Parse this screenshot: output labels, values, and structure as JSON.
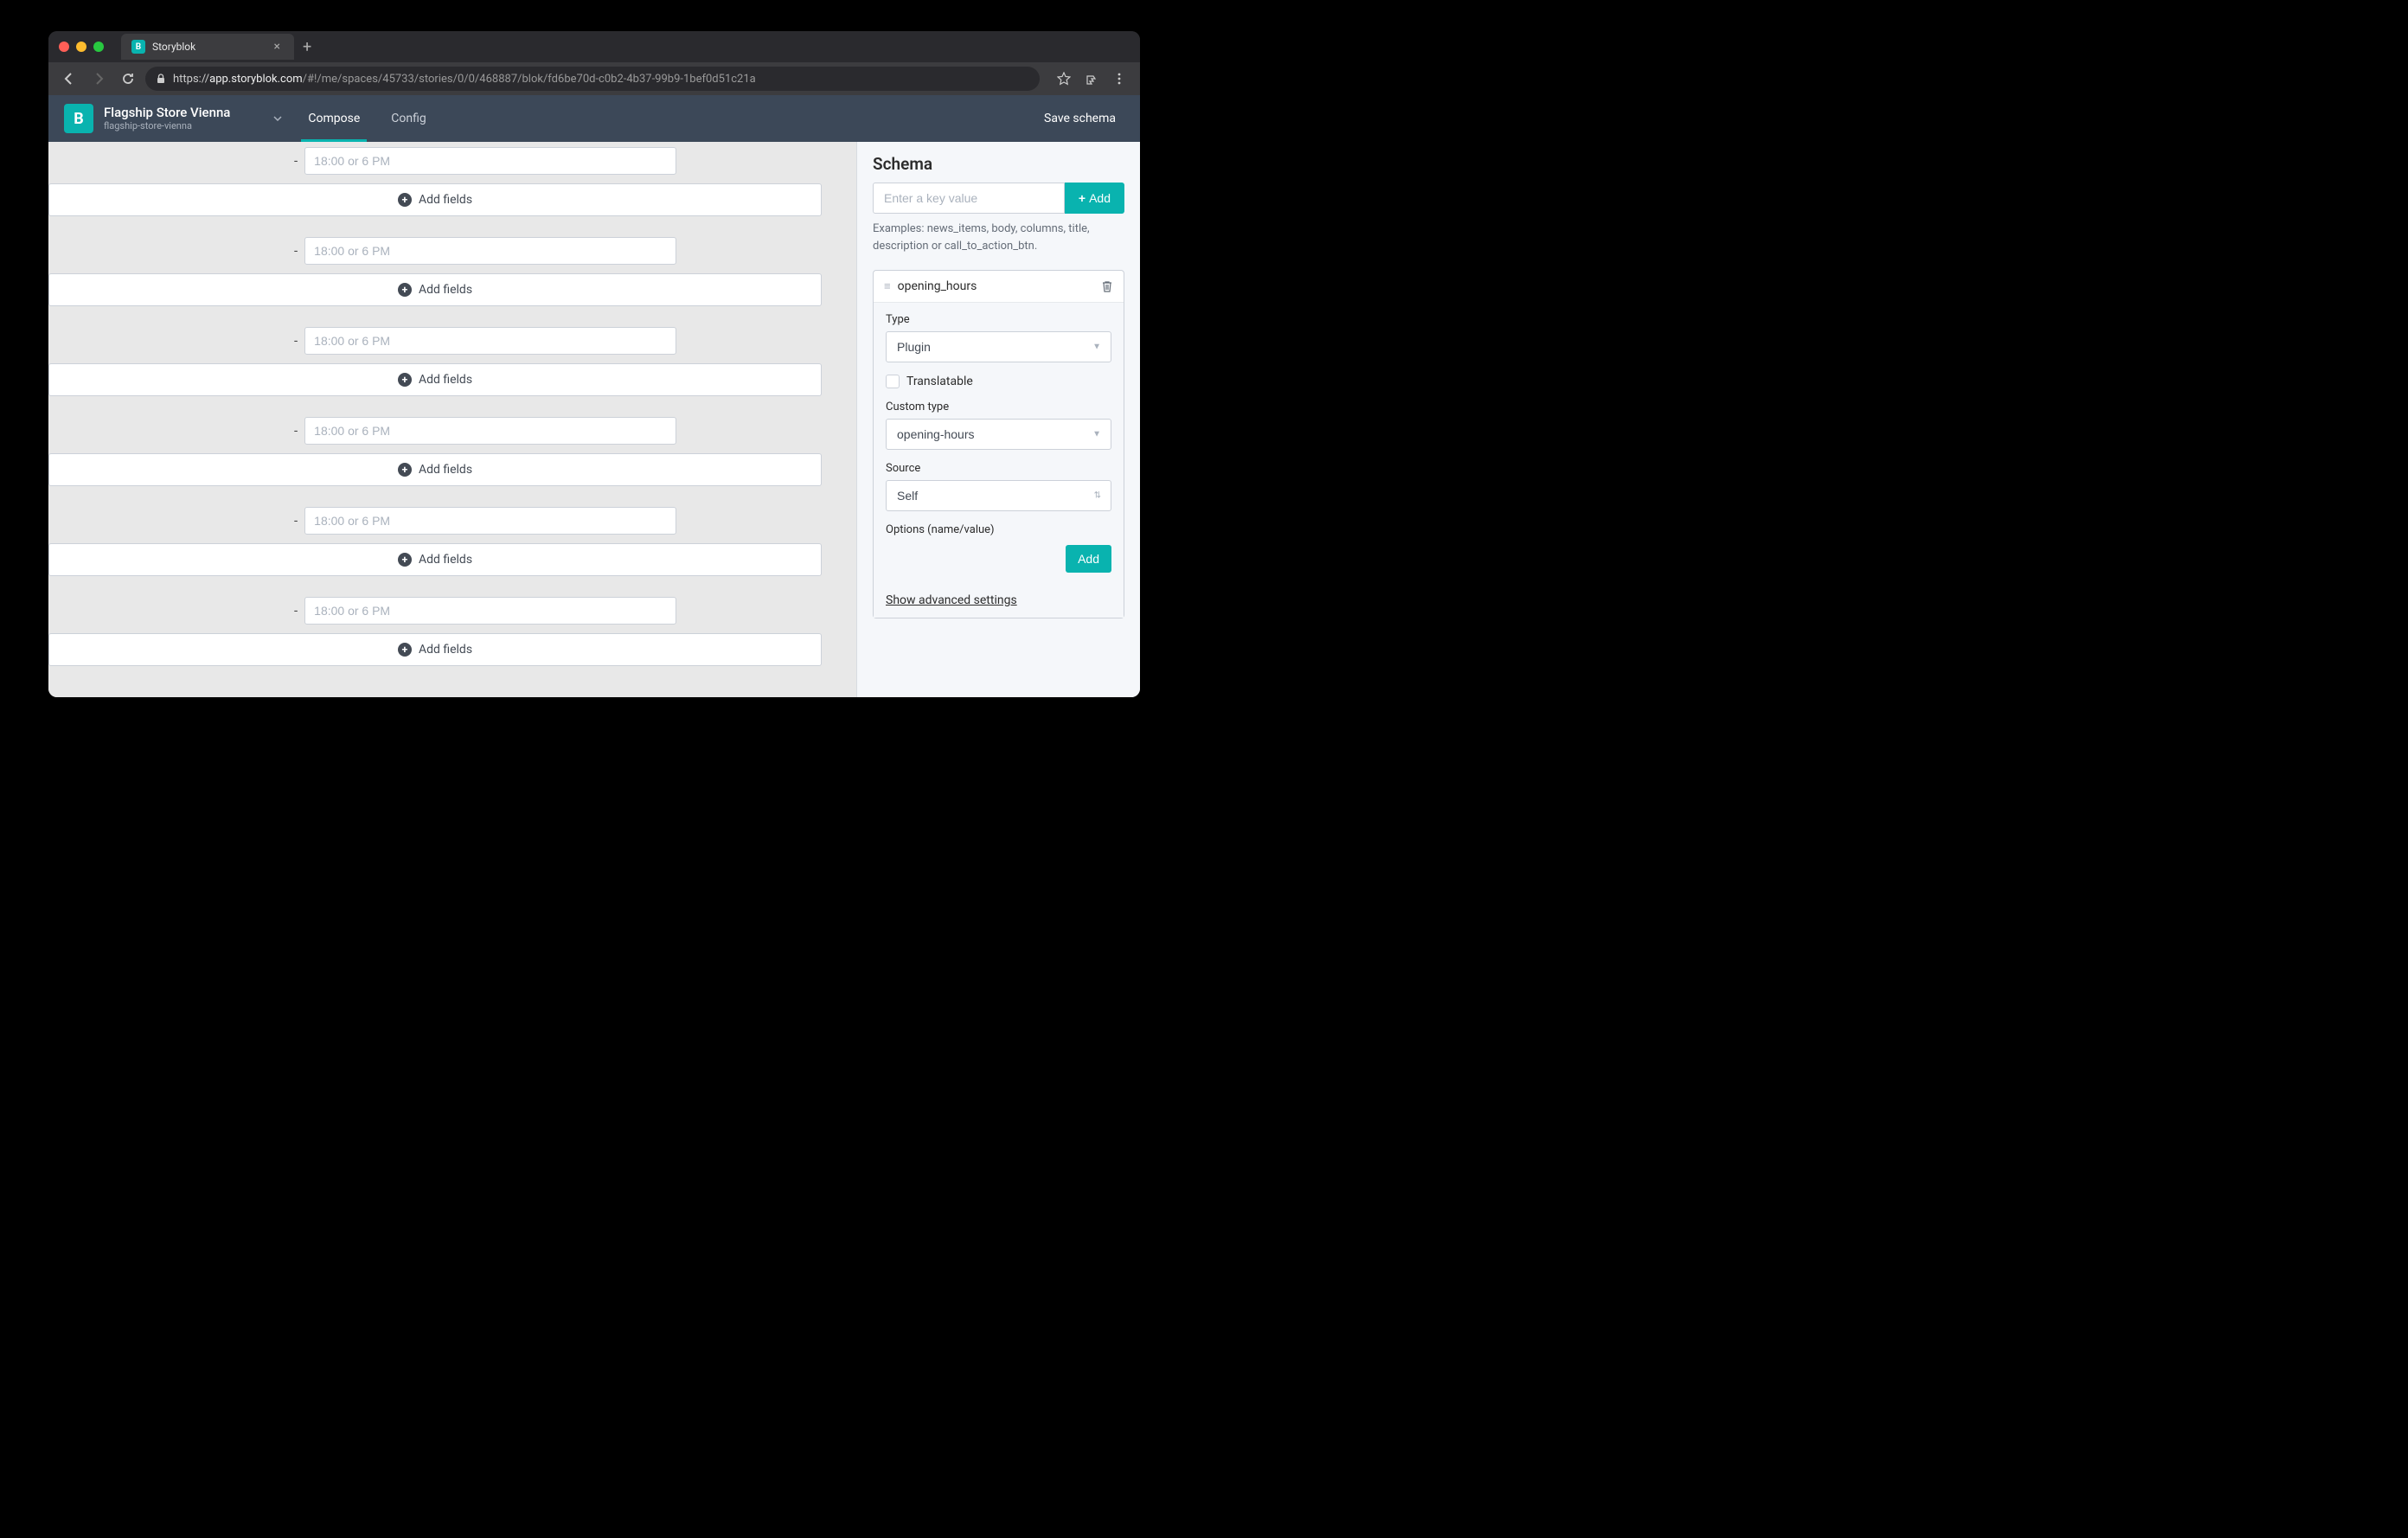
{
  "browser": {
    "tab_title": "Storyblok",
    "url_https": "https://",
    "url_domain": "app.storyblok.com",
    "url_path": "/#!/me/spaces/45733/stories/0/0/468887/blok/fd6be70d-c0b2-4b37-99b9-1bef0d51c21a"
  },
  "header": {
    "space_title": "Flagship Store Vienna",
    "space_slug": "flagship-store-vienna",
    "tabs": {
      "compose": "Compose",
      "config": "Config"
    },
    "save": "Save schema"
  },
  "main": {
    "time_placeholder": "18:00 or 6 PM",
    "add_fields": "Add fields",
    "rows": [
      1,
      2,
      3,
      4,
      5,
      6
    ]
  },
  "schema": {
    "title": "Schema",
    "key_placeholder": "Enter a key value",
    "add_label": "Add",
    "examples": "Examples: news_items, body, columns, title, description or call_to_action_btn.",
    "field_name": "opening_hours",
    "type_label": "Type",
    "type_value": "Plugin",
    "translatable": "Translatable",
    "custom_type_label": "Custom type",
    "custom_type_value": "opening-hours",
    "source_label": "Source",
    "source_value": "Self",
    "options_label": "Options (name/value)",
    "add_option": "Add",
    "advanced": "Show advanced settings"
  }
}
